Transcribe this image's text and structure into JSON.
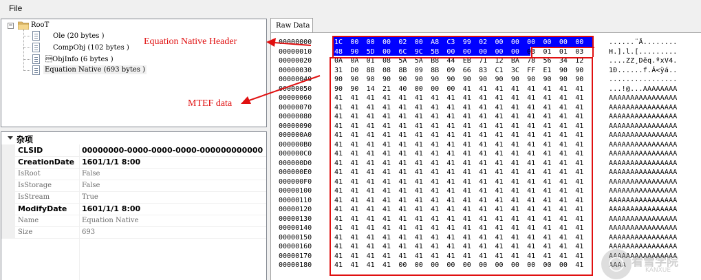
{
  "menu": {
    "file": "File"
  },
  "tree": {
    "root": "RooT",
    "items": [
      {
        "label": "Ole (20 bytes )"
      },
      {
        "label": "CompObj (102 bytes )"
      },
      {
        "label": "\u0001ObjInfo (6 bytes )"
      },
      {
        "label": "Equation Native (693 bytes )"
      }
    ]
  },
  "properties": {
    "section": "杂项",
    "rows": [
      {
        "name": "CLSID",
        "value": "00000000-0000-0000-0000-000000000000",
        "style": "bold"
      },
      {
        "name": "CreationDate",
        "value": "1601/1/1 8:00",
        "style": "bold"
      },
      {
        "name": "IsRoot",
        "value": "False",
        "style": "dim"
      },
      {
        "name": "IsStorage",
        "value": "False",
        "style": "dim"
      },
      {
        "name": "IsStream",
        "value": "True",
        "style": "dim"
      },
      {
        "name": "ModifyDate",
        "value": "1601/1/1 8:00",
        "style": "bold"
      },
      {
        "name": "Name",
        "value": "Equation Native",
        "style": "dim"
      },
      {
        "name": "Size",
        "value": "693",
        "style": "dim"
      }
    ]
  },
  "hex": {
    "tab": "Raw Data",
    "rows": [
      {
        "offset": "00000000",
        "bytes": [
          "1C",
          "00",
          "00",
          "00",
          "02",
          "00",
          "A8",
          "C3",
          "99",
          "02",
          "00",
          "00",
          "00",
          "00",
          "00",
          "00"
        ],
        "ascii": "......¨Ã........"
      },
      {
        "offset": "00000010",
        "bytes": [
          "48",
          "90",
          "5D",
          "00",
          "6C",
          "9C",
          "5B",
          "00",
          "00",
          "00",
          "00",
          "00",
          "03",
          "01",
          "01",
          "03"
        ],
        "ascii": "H.].l.[........."
      },
      {
        "offset": "00000020",
        "bytes": [
          "0A",
          "0A",
          "01",
          "08",
          "5A",
          "5A",
          "B8",
          "44",
          "EB",
          "71",
          "12",
          "BA",
          "78",
          "56",
          "34",
          "12"
        ],
        "ascii": "....ZZ¸Dëq.ºxV4."
      },
      {
        "offset": "00000030",
        "bytes": [
          "31",
          "D0",
          "8B",
          "08",
          "8B",
          "09",
          "8B",
          "09",
          "66",
          "83",
          "C1",
          "3C",
          "FF",
          "E1",
          "90",
          "90"
        ],
        "ascii": "1Ð......f.Á<ÿá.."
      },
      {
        "offset": "00000040",
        "bytes": [
          "90",
          "90",
          "90",
          "90",
          "90",
          "90",
          "90",
          "90",
          "90",
          "90",
          "90",
          "90",
          "90",
          "90",
          "90",
          "90"
        ],
        "ascii": "................"
      },
      {
        "offset": "00000050",
        "bytes": [
          "90",
          "90",
          "14",
          "21",
          "40",
          "00",
          "00",
          "00",
          "41",
          "41",
          "41",
          "41",
          "41",
          "41",
          "41",
          "41"
        ],
        "ascii": "...!@...AAAAAAAA"
      },
      {
        "offset": "00000060",
        "bytes": [
          "41",
          "41",
          "41",
          "41",
          "41",
          "41",
          "41",
          "41",
          "41",
          "41",
          "41",
          "41",
          "41",
          "41",
          "41",
          "41"
        ],
        "ascii": "AAAAAAAAAAAAAAAA"
      },
      {
        "offset": "00000070",
        "bytes": [
          "41",
          "41",
          "41",
          "41",
          "41",
          "41",
          "41",
          "41",
          "41",
          "41",
          "41",
          "41",
          "41",
          "41",
          "41",
          "41"
        ],
        "ascii": "AAAAAAAAAAAAAAAA"
      },
      {
        "offset": "00000080",
        "bytes": [
          "41",
          "41",
          "41",
          "41",
          "41",
          "41",
          "41",
          "41",
          "41",
          "41",
          "41",
          "41",
          "41",
          "41",
          "41",
          "41"
        ],
        "ascii": "AAAAAAAAAAAAAAAA"
      },
      {
        "offset": "00000090",
        "bytes": [
          "41",
          "41",
          "41",
          "41",
          "41",
          "41",
          "41",
          "41",
          "41",
          "41",
          "41",
          "41",
          "41",
          "41",
          "41",
          "41"
        ],
        "ascii": "AAAAAAAAAAAAAAAA"
      },
      {
        "offset": "000000A0",
        "bytes": [
          "41",
          "41",
          "41",
          "41",
          "41",
          "41",
          "41",
          "41",
          "41",
          "41",
          "41",
          "41",
          "41",
          "41",
          "41",
          "41"
        ],
        "ascii": "AAAAAAAAAAAAAAAA"
      },
      {
        "offset": "000000B0",
        "bytes": [
          "41",
          "41",
          "41",
          "41",
          "41",
          "41",
          "41",
          "41",
          "41",
          "41",
          "41",
          "41",
          "41",
          "41",
          "41",
          "41"
        ],
        "ascii": "AAAAAAAAAAAAAAAA"
      },
      {
        "offset": "000000C0",
        "bytes": [
          "41",
          "41",
          "41",
          "41",
          "41",
          "41",
          "41",
          "41",
          "41",
          "41",
          "41",
          "41",
          "41",
          "41",
          "41",
          "41"
        ],
        "ascii": "AAAAAAAAAAAAAAAA"
      },
      {
        "offset": "000000D0",
        "bytes": [
          "41",
          "41",
          "41",
          "41",
          "41",
          "41",
          "41",
          "41",
          "41",
          "41",
          "41",
          "41",
          "41",
          "41",
          "41",
          "41"
        ],
        "ascii": "AAAAAAAAAAAAAAAA"
      },
      {
        "offset": "000000E0",
        "bytes": [
          "41",
          "41",
          "41",
          "41",
          "41",
          "41",
          "41",
          "41",
          "41",
          "41",
          "41",
          "41",
          "41",
          "41",
          "41",
          "41"
        ],
        "ascii": "AAAAAAAAAAAAAAAA"
      },
      {
        "offset": "000000F0",
        "bytes": [
          "41",
          "41",
          "41",
          "41",
          "41",
          "41",
          "41",
          "41",
          "41",
          "41",
          "41",
          "41",
          "41",
          "41",
          "41",
          "41"
        ],
        "ascii": "AAAAAAAAAAAAAAAA"
      },
      {
        "offset": "00000100",
        "bytes": [
          "41",
          "41",
          "41",
          "41",
          "41",
          "41",
          "41",
          "41",
          "41",
          "41",
          "41",
          "41",
          "41",
          "41",
          "41",
          "41"
        ],
        "ascii": "AAAAAAAAAAAAAAAA"
      },
      {
        "offset": "00000110",
        "bytes": [
          "41",
          "41",
          "41",
          "41",
          "41",
          "41",
          "41",
          "41",
          "41",
          "41",
          "41",
          "41",
          "41",
          "41",
          "41",
          "41"
        ],
        "ascii": "AAAAAAAAAAAAAAAA"
      },
      {
        "offset": "00000120",
        "bytes": [
          "41",
          "41",
          "41",
          "41",
          "41",
          "41",
          "41",
          "41",
          "41",
          "41",
          "41",
          "41",
          "41",
          "41",
          "41",
          "41"
        ],
        "ascii": "AAAAAAAAAAAAAAAA"
      },
      {
        "offset": "00000130",
        "bytes": [
          "41",
          "41",
          "41",
          "41",
          "41",
          "41",
          "41",
          "41",
          "41",
          "41",
          "41",
          "41",
          "41",
          "41",
          "41",
          "41"
        ],
        "ascii": "AAAAAAAAAAAAAAAA"
      },
      {
        "offset": "00000140",
        "bytes": [
          "41",
          "41",
          "41",
          "41",
          "41",
          "41",
          "41",
          "41",
          "41",
          "41",
          "41",
          "41",
          "41",
          "41",
          "41",
          "41"
        ],
        "ascii": "AAAAAAAAAAAAAAAA"
      },
      {
        "offset": "00000150",
        "bytes": [
          "41",
          "41",
          "41",
          "41",
          "41",
          "41",
          "41",
          "41",
          "41",
          "41",
          "41",
          "41",
          "41",
          "41",
          "41",
          "41"
        ],
        "ascii": "AAAAAAAAAAAAAAAA"
      },
      {
        "offset": "00000160",
        "bytes": [
          "41",
          "41",
          "41",
          "41",
          "41",
          "41",
          "41",
          "41",
          "41",
          "41",
          "41",
          "41",
          "41",
          "41",
          "41",
          "41"
        ],
        "ascii": "AAAAAAAAAAAAAAAA"
      },
      {
        "offset": "00000170",
        "bytes": [
          "41",
          "41",
          "41",
          "41",
          "41",
          "41",
          "41",
          "41",
          "41",
          "41",
          "41",
          "41",
          "41",
          "41",
          "41",
          "41"
        ],
        "ascii": "AAAAAAAAAAAAAAAA"
      },
      {
        "offset": "00000180",
        "bytes": [
          "41",
          "41",
          "41",
          "41",
          "00",
          "00",
          "00",
          "00",
          "00",
          "00",
          "00",
          "00",
          "00",
          "00",
          "00",
          "41"
        ],
        "ascii": "AAAA"
      }
    ]
  },
  "annotations": {
    "header": "Equation Native Header",
    "mtef": "MTEF data"
  },
  "watermark": {
    "text": "看雪学院",
    "sub": "KANXUE"
  },
  "colors": {
    "selection": "#0000ff",
    "annotation": "#e01010"
  }
}
